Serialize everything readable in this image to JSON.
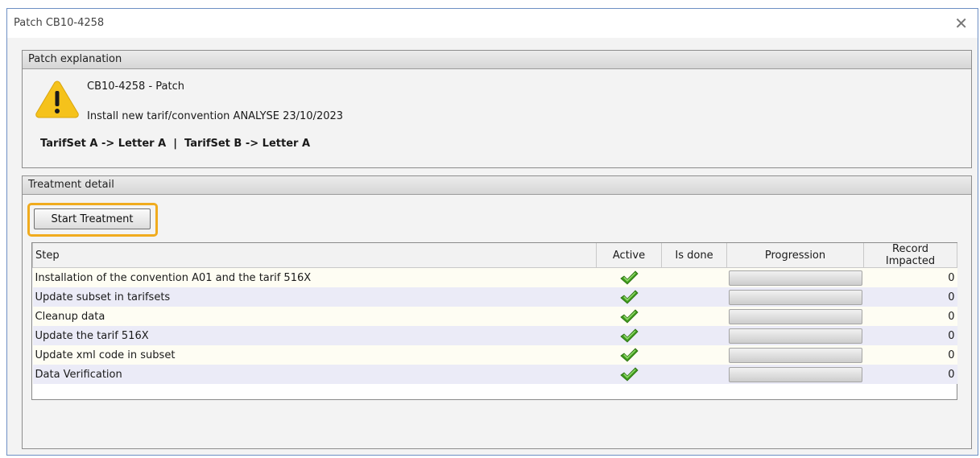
{
  "window": {
    "title": "Patch CB10-4258",
    "close_glyph": "✕"
  },
  "explanation": {
    "header": "Patch explanation",
    "icon": "warning-icon",
    "line1": "CB10-4258 - Patch",
    "line2": "Install new tarif/convention ANALYSE 23/10/2023",
    "tarif_mapping": "TarifSet A -> Letter A  |  TarifSet B -> Letter A"
  },
  "treatment": {
    "header": "Treatment detail",
    "start_button": "Start Treatment",
    "columns": [
      "Step",
      "Active",
      "Is done",
      "Progression",
      "Record Impacted"
    ],
    "rows": [
      {
        "step": "Installation of the convention A01 and the tarif 516X",
        "active": true,
        "is_done": "",
        "progression": 0,
        "record_impacted": "0"
      },
      {
        "step": "Update subset in tarifsets",
        "active": true,
        "is_done": "",
        "progression": 0,
        "record_impacted": "0"
      },
      {
        "step": "Cleanup data",
        "active": true,
        "is_done": "",
        "progression": 0,
        "record_impacted": "0"
      },
      {
        "step": "Update the tarif 516X",
        "active": true,
        "is_done": "",
        "progression": 0,
        "record_impacted": "0"
      },
      {
        "step": "Update xml code in subset",
        "active": true,
        "is_done": "",
        "progression": 0,
        "record_impacted": "0"
      },
      {
        "step": "Data Verification",
        "active": true,
        "is_done": "",
        "progression": 0,
        "record_impacted": "0"
      }
    ]
  },
  "colors": {
    "focus_ring": "#f0ab1e",
    "row_odd": "#fefdf3",
    "row_even": "#ebebf7",
    "check_green": "#3e9a1c",
    "warning_yellow": "#f5c21b"
  }
}
